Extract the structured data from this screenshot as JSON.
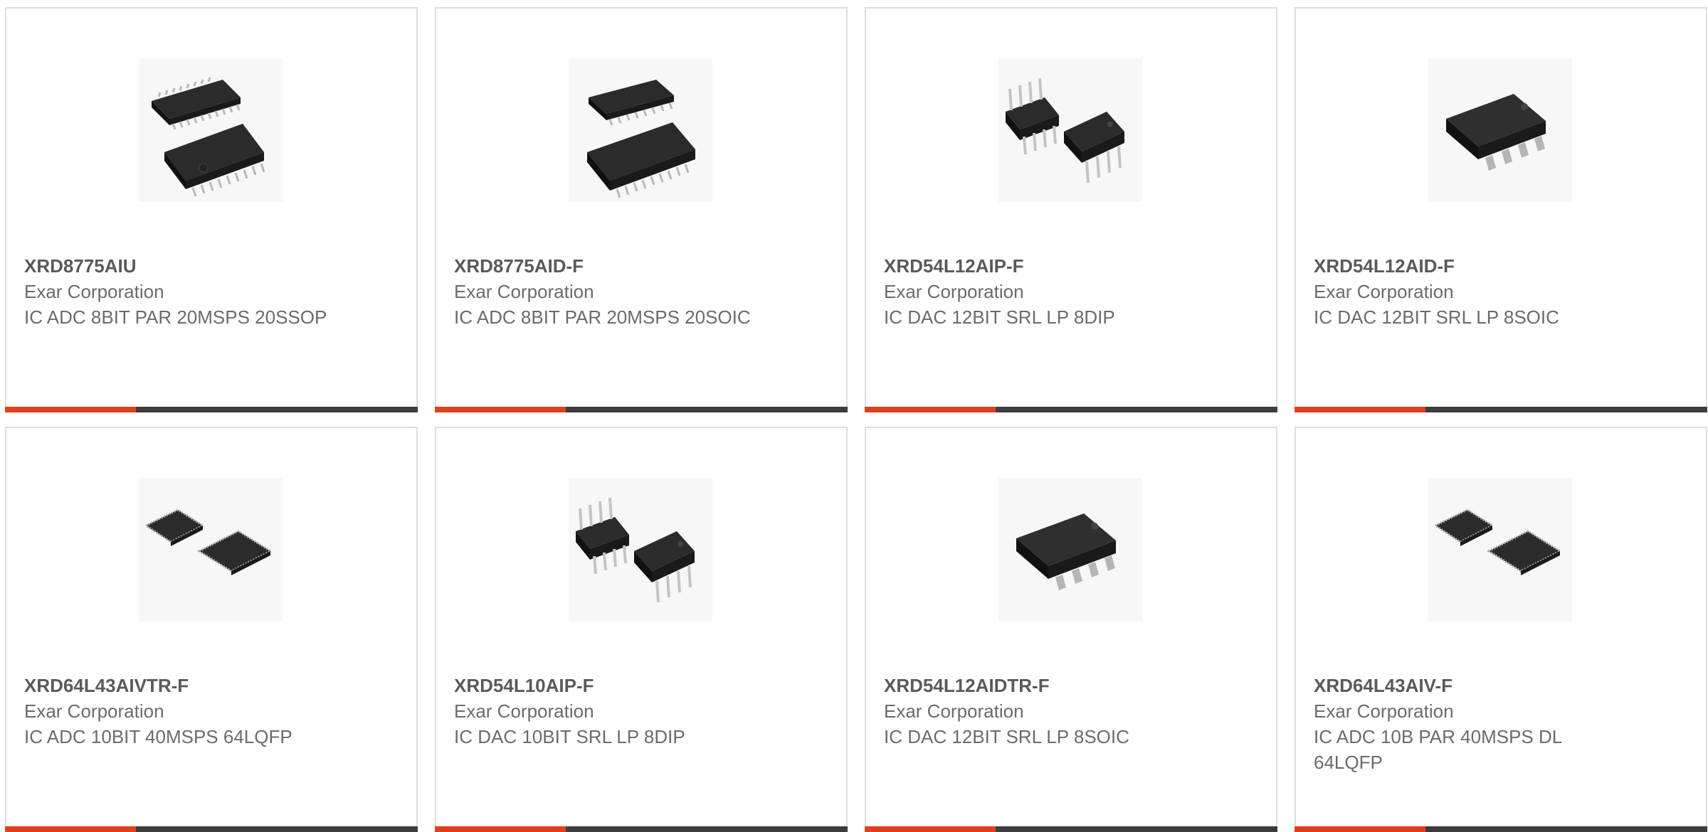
{
  "products": [
    {
      "part": "XRD8775AIU",
      "manufacturer": "Exar Corporation",
      "description": "IC ADC 8BIT PAR 20MSPS 20SSOP",
      "package_icon": "ssop-chip-icon"
    },
    {
      "part": "XRD8775AID-F",
      "manufacturer": "Exar Corporation",
      "description": "IC ADC 8BIT PAR 20MSPS 20SOIC",
      "package_icon": "soic-chip-icon"
    },
    {
      "part": "XRD54L12AIP-F",
      "manufacturer": "Exar Corporation",
      "description": "IC DAC 12BIT SRL LP 8DIP",
      "package_icon": "dip-chip-icon"
    },
    {
      "part": "XRD54L12AID-F",
      "manufacturer": "Exar Corporation",
      "description": "IC DAC 12BIT SRL LP 8SOIC",
      "package_icon": "soic8-chip-icon"
    },
    {
      "part": "XRD64L43AIVTR-F",
      "manufacturer": "Exar Corporation",
      "description": "IC ADC 10BIT 40MSPS 64LQFP",
      "package_icon": "lqfp-chip-icon"
    },
    {
      "part": "XRD54L10AIP-F",
      "manufacturer": "Exar Corporation",
      "description": "IC DAC 10BIT SRL LP 8DIP",
      "package_icon": "dip-chip-icon"
    },
    {
      "part": "XRD54L12AIDTR-F",
      "manufacturer": "Exar Corporation",
      "description": "IC DAC 12BIT SRL LP 8SOIC",
      "package_icon": "soic8-chip-icon"
    },
    {
      "part": "XRD64L43AIV-F",
      "manufacturer": "Exar Corporation",
      "description": "IC ADC 10B PAR 40MSPS DL 64LQFP",
      "package_icon": "lqfp-chip-icon"
    }
  ],
  "colors": {
    "accent": "#e2401c",
    "bar": "#3d3d3d",
    "border": "#dedede",
    "text": "#6b6b6b"
  }
}
